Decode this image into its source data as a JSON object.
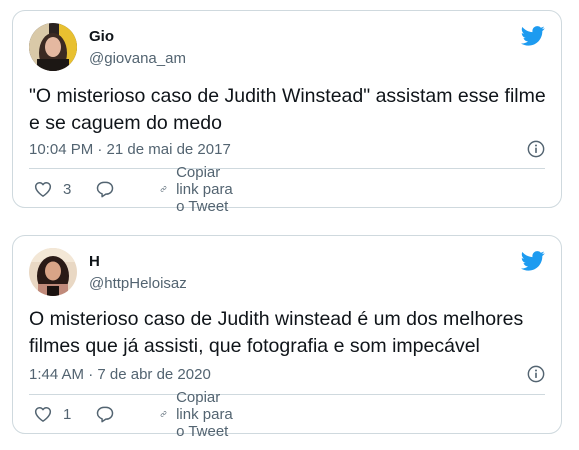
{
  "tweets": [
    {
      "name": "Gio",
      "handle": "@giovana_am",
      "text": "\"O misterioso caso de Judith Winstead\" assistam esse filme e se caguem do medo",
      "timestamp": "10:04 PM · 21 de mai de 2017",
      "likes": "3",
      "copy_link_label": "Copiar link para o Tweet"
    },
    {
      "name": "H",
      "handle": "@httpHeloisaz",
      "text": "O misterioso caso de Judith winstead é um dos melhores filmes que já assisti, que fotografia e som impecável",
      "timestamp": "1:44 AM · 7 de abr de 2020",
      "likes": "1",
      "copy_link_label": "Copiar link para o Tweet"
    }
  ],
  "icons": {
    "brand": "twitter-bird-icon",
    "info": "info-icon",
    "like": "heart-icon",
    "reply": "reply-icon",
    "link": "link-icon"
  },
  "colors": {
    "twitter_blue": "#1d9bf0",
    "text_primary": "#0f1419",
    "text_secondary": "#536471",
    "border": "#cfd9de"
  }
}
